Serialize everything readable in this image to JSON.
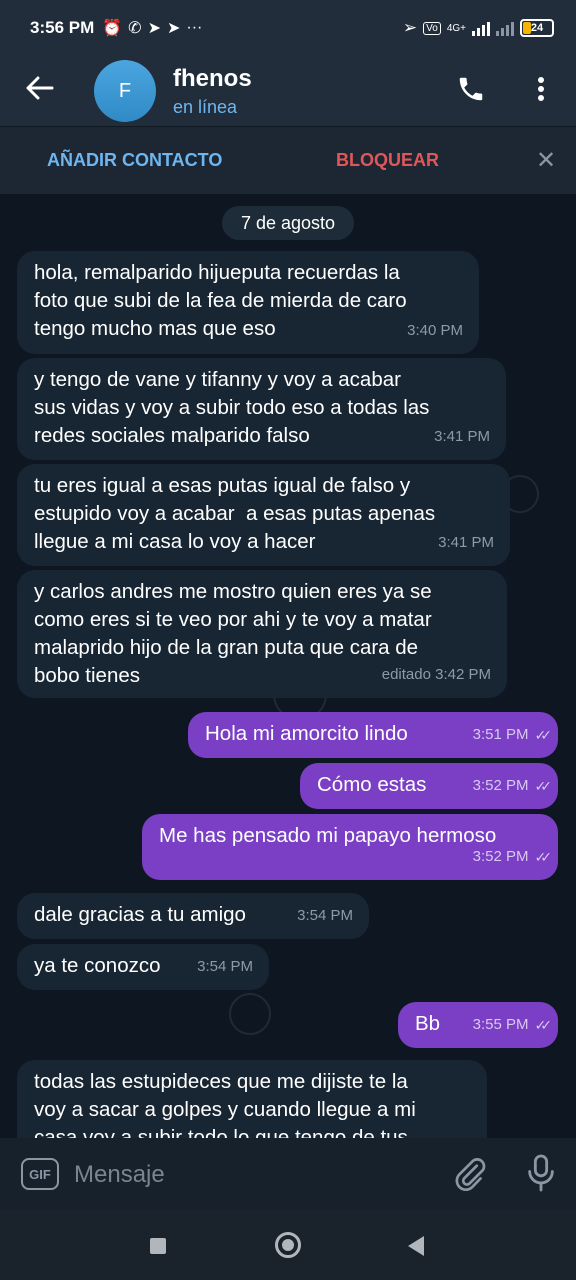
{
  "status_bar": {
    "time": "3:56 PM",
    "left_icons": [
      "alarm-icon",
      "whatsapp-icon",
      "telegram-icon",
      "telegram-icon",
      "more-icon"
    ],
    "right_icons": [
      "location-icon",
      "volte-icon",
      "network-4g-icon",
      "signal-icon",
      "signal-icon",
      "battery-icon"
    ],
    "network": "4G+",
    "battery": "24"
  },
  "header": {
    "avatar_letter": "F",
    "contact_name": "fhenos",
    "contact_status": "en línea",
    "back_icon": "arrow-left-icon",
    "call_icon": "phone-icon",
    "menu_icon": "more-vertical-icon"
  },
  "action_bar": {
    "add_contact": "AÑADIR CONTACTO",
    "block": "BLOQUEAR",
    "close": "✕"
  },
  "date_chip": "7 de agosto",
  "messages": [
    {
      "dir": "in",
      "lines": [
        "hola, remalparido hijueputa recuerdas la",
        "foto que subi de la fea de mierda de caro",
        "tengo mucho mas que eso"
      ],
      "time": "3:40 PM"
    },
    {
      "dir": "in",
      "lines": [
        "y tengo de vane y tifanny y voy a acabar",
        "sus vidas y voy a subir todo eso a todas las",
        "redes sociales malparido falso"
      ],
      "time": "3:41 PM"
    },
    {
      "dir": "in",
      "lines": [
        "tu eres igual a esas putas igual de falso y",
        "estupido voy a acabar  a esas putas apenas",
        "llegue a mi casa lo voy a hacer"
      ],
      "time": "3:41 PM"
    },
    {
      "dir": "in",
      "lines": [
        "y carlos andres me mostro quien eres ya se",
        "como eres si te veo por ahi y te voy a matar",
        "malaprido hijo de la gran puta que cara de",
        "bobo tienes"
      ],
      "time": "editado 3:42 PM"
    },
    {
      "dir": "out",
      "lines": [
        "Hola mi amorcito lindo"
      ],
      "time": "3:51 PM"
    },
    {
      "dir": "out",
      "lines": [
        "Cómo estas"
      ],
      "time": "3:52 PM"
    },
    {
      "dir": "out",
      "lines": [
        "Me has pensado mi papayo hermoso"
      ],
      "time": "3:52 PM"
    },
    {
      "dir": "in",
      "lines": [
        "dale gracias a tu amigo"
      ],
      "time": "3:54 PM"
    },
    {
      "dir": "in",
      "lines": [
        "ya te conozco"
      ],
      "time": "3:54 PM"
    },
    {
      "dir": "out",
      "lines": [
        "Bb"
      ],
      "time": "3:55 PM"
    },
    {
      "dir": "in",
      "lines": [
        "todas las estupideces que me dijiste te la",
        "voy a sacar a golpes y cuando llegue a mi",
        "casa voy a subir todo lo que tengo de tus"
      ],
      "time": ""
    }
  ],
  "input_bar": {
    "gif_label": "GIF",
    "placeholder": "Mensaje",
    "attach_icon": "paperclip-icon",
    "mic_icon": "microphone-icon"
  },
  "nav_bar": {
    "icons": [
      "recents-square-icon",
      "home-circle-icon",
      "back-triangle-icon"
    ]
  },
  "colors": {
    "header_bg": "#212d3b",
    "chat_bg": "#0e1621",
    "incoming_bubble": "#182533",
    "outgoing_bubble": "#7a3fc4",
    "accent_blue": "#6fb6f0",
    "danger_red": "#e0575b"
  }
}
